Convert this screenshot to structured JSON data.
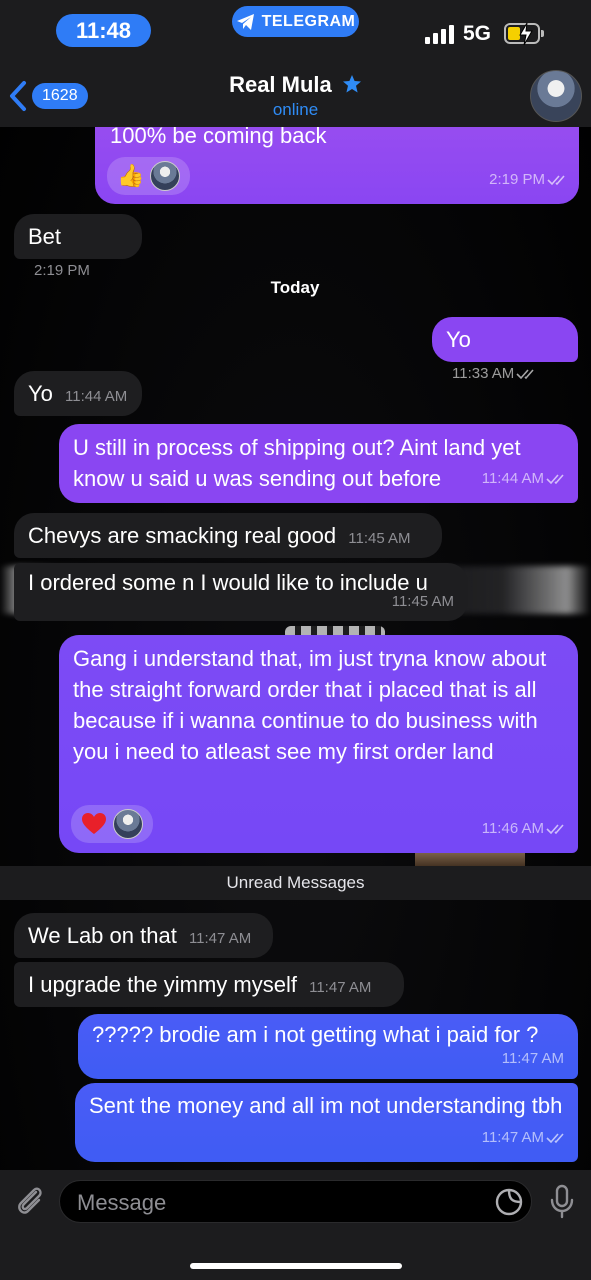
{
  "status_bar": {
    "time": "11:48",
    "app_pill": "TELEGRAM",
    "network": "5G"
  },
  "header": {
    "back_count": "1628",
    "contact_name": "Real Mula",
    "status": "online"
  },
  "messages": [
    {
      "dir": "out",
      "text": "100% be coming back",
      "time": "2:19 PM",
      "reactions": [
        "thumbs-up",
        "avatar"
      ]
    },
    {
      "dir": "in",
      "text": "Bet",
      "time": "2:19 PM"
    },
    {
      "dir": "separator",
      "text": "Today"
    },
    {
      "dir": "out",
      "text": "Yo",
      "time": "11:33 AM"
    },
    {
      "dir": "in",
      "text": "Yo",
      "time": "11:44 AM"
    },
    {
      "dir": "out",
      "text": "U still in process of shipping out? Aint land yet know u said u was sending out before",
      "time": "11:44 AM"
    },
    {
      "dir": "in",
      "text": "Chevys are smacking real good",
      "time": "11:45 AM"
    },
    {
      "dir": "in",
      "text": "I ordered some n I would like to include u",
      "time": "11:45 AM"
    },
    {
      "dir": "out",
      "text": "Gang i understand that, im just tryna know about the straight forward order that i placed that is all because if i wanna continue to do business with you i need to atleast see my first order land",
      "time": "11:46 AM",
      "reactions": [
        "heart",
        "avatar"
      ]
    },
    {
      "dir": "separator",
      "text": "Unread Messages"
    },
    {
      "dir": "in",
      "text": "We Lab on that",
      "time": "11:47 AM"
    },
    {
      "dir": "in",
      "text": "I upgrade the yimmy myself",
      "time": "11:47 AM"
    },
    {
      "dir": "out",
      "text": "????? brodie am i not getting what i paid for ?",
      "time": "11:47 AM"
    },
    {
      "dir": "out",
      "text": "Sent the money and all im not understanding tbh",
      "time": "11:47 AM"
    }
  ],
  "input": {
    "placeholder": "Message"
  },
  "icons": [
    "telegram-icon",
    "back-chevron-icon",
    "star-icon",
    "attach-icon",
    "sticker-icon",
    "microphone-icon",
    "read-ticks-icon",
    "heart-icon",
    "thumbs-up-icon"
  ],
  "colors": {
    "accent": "#2f7cf6",
    "bubble_out_purple": "#8a46f2",
    "bubble_out_blue": "#3f5cf4",
    "bubble_in": "#1e1e20"
  }
}
